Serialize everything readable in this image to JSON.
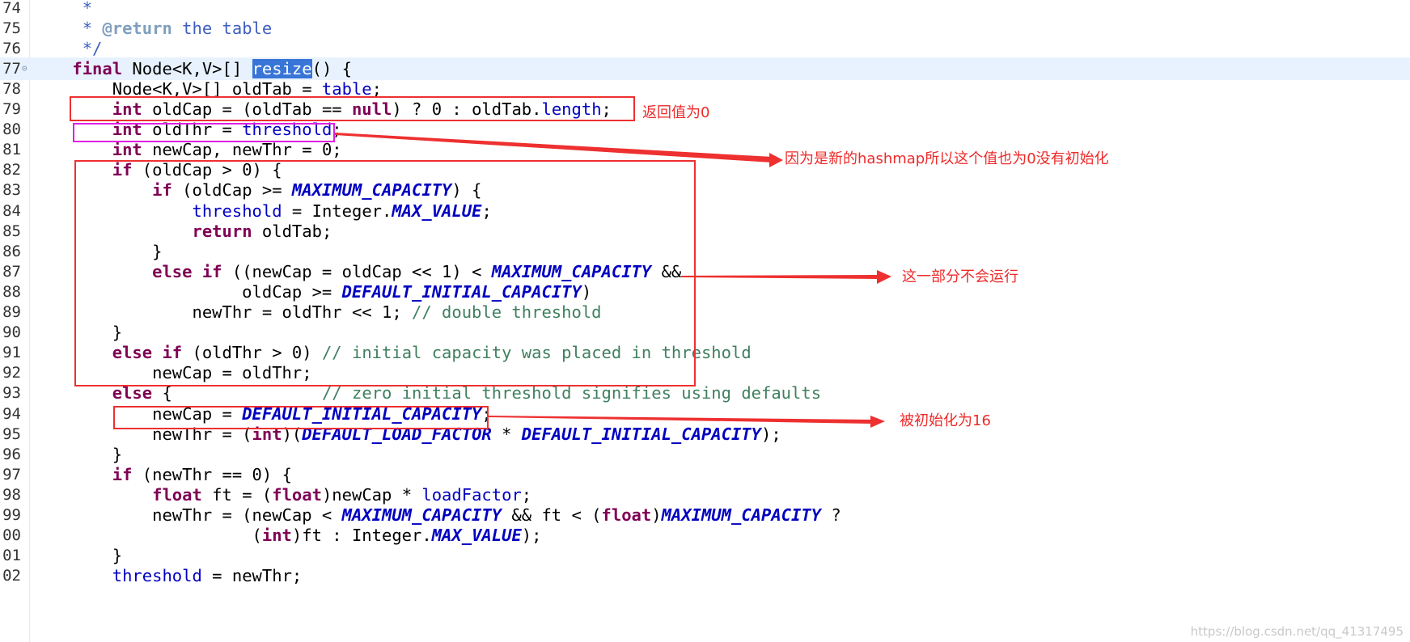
{
  "lines": [
    {
      "num": "74",
      "parts": [
        {
          "t": "     *",
          "c": "jd"
        }
      ]
    },
    {
      "num": "75",
      "parts": [
        {
          "t": "     * ",
          "c": "jd"
        },
        {
          "t": "@return",
          "c": "tag"
        },
        {
          "t": " the table",
          "c": "jd"
        }
      ]
    },
    {
      "num": "76",
      "parts": [
        {
          "t": "     */",
          "c": "jd"
        }
      ]
    },
    {
      "num": "77",
      "current": true,
      "fold": true,
      "parts": [
        {
          "t": "    "
        },
        {
          "t": "final",
          "c": "kw"
        },
        {
          "t": " Node<K,V>[] "
        },
        {
          "t": "resize",
          "c": "sel"
        },
        {
          "t": "() {"
        }
      ]
    },
    {
      "num": "78",
      "parts": [
        {
          "t": "        Node<K,V>[] oldTab = "
        },
        {
          "t": "table",
          "c": "fld"
        },
        {
          "t": ";"
        }
      ]
    },
    {
      "num": "79",
      "parts": [
        {
          "t": "        "
        },
        {
          "t": "int",
          "c": "kw"
        },
        {
          "t": " oldCap = (oldTab == "
        },
        {
          "t": "null",
          "c": "kw"
        },
        {
          "t": ") ? 0 : oldTab."
        },
        {
          "t": "length",
          "c": "fld"
        },
        {
          "t": ";"
        }
      ]
    },
    {
      "num": "80",
      "parts": [
        {
          "t": "        "
        },
        {
          "t": "int",
          "c": "kw"
        },
        {
          "t": " oldThr = "
        },
        {
          "t": "threshold",
          "c": "fld"
        },
        {
          "t": ";"
        }
      ]
    },
    {
      "num": "81",
      "parts": [
        {
          "t": "        "
        },
        {
          "t": "int",
          "c": "kw"
        },
        {
          "t": " newCap, newThr = 0;"
        }
      ]
    },
    {
      "num": "82",
      "parts": [
        {
          "t": "        "
        },
        {
          "t": "if",
          "c": "kw"
        },
        {
          "t": " (oldCap > 0) {"
        }
      ]
    },
    {
      "num": "83",
      "parts": [
        {
          "t": "            "
        },
        {
          "t": "if",
          "c": "kw"
        },
        {
          "t": " (oldCap >= "
        },
        {
          "t": "MAXIMUM_CAPACITY",
          "c": "cst"
        },
        {
          "t": ") {"
        }
      ]
    },
    {
      "num": "84",
      "parts": [
        {
          "t": "                "
        },
        {
          "t": "threshold",
          "c": "fld"
        },
        {
          "t": " = Integer."
        },
        {
          "t": "MAX_VALUE",
          "c": "cst"
        },
        {
          "t": ";"
        }
      ]
    },
    {
      "num": "85",
      "parts": [
        {
          "t": "                "
        },
        {
          "t": "return",
          "c": "kw"
        },
        {
          "t": " oldTab;"
        }
      ]
    },
    {
      "num": "86",
      "parts": [
        {
          "t": "            }"
        }
      ]
    },
    {
      "num": "87",
      "parts": [
        {
          "t": "            "
        },
        {
          "t": "else if",
          "c": "kw"
        },
        {
          "t": " ((newCap = oldCap << 1) < "
        },
        {
          "t": "MAXIMUM_CAPACITY",
          "c": "cst"
        },
        {
          "t": " &&"
        }
      ]
    },
    {
      "num": "88",
      "parts": [
        {
          "t": "                     oldCap >= "
        },
        {
          "t": "DEFAULT_INITIAL_CAPACITY",
          "c": "cst"
        },
        {
          "t": ")"
        }
      ]
    },
    {
      "num": "89",
      "parts": [
        {
          "t": "                newThr = oldThr << 1; "
        },
        {
          "t": "// double threshold",
          "c": "cmt"
        }
      ]
    },
    {
      "num": "90",
      "parts": [
        {
          "t": "        }"
        }
      ]
    },
    {
      "num": "91",
      "parts": [
        {
          "t": "        "
        },
        {
          "t": "else if",
          "c": "kw"
        },
        {
          "t": " (oldThr > 0) "
        },
        {
          "t": "// initial capacity was placed in threshold",
          "c": "cmt"
        }
      ]
    },
    {
      "num": "92",
      "parts": [
        {
          "t": "            newCap = oldThr;"
        }
      ]
    },
    {
      "num": "93",
      "parts": [
        {
          "t": "        "
        },
        {
          "t": "else",
          "c": "kw"
        },
        {
          "t": " {               "
        },
        {
          "t": "// zero initial threshold signifies using defaults",
          "c": "cmt"
        }
      ]
    },
    {
      "num": "94",
      "parts": [
        {
          "t": "            newCap = "
        },
        {
          "t": "DEFAULT_INITIAL_CAPACITY",
          "c": "cst"
        },
        {
          "t": ";"
        }
      ]
    },
    {
      "num": "95",
      "parts": [
        {
          "t": "            newThr = ("
        },
        {
          "t": "int",
          "c": "kw"
        },
        {
          "t": ")("
        },
        {
          "t": "DEFAULT_LOAD_FACTOR",
          "c": "cst"
        },
        {
          "t": " * "
        },
        {
          "t": "DEFAULT_INITIAL_CAPACITY",
          "c": "cst"
        },
        {
          "t": ");"
        }
      ]
    },
    {
      "num": "96",
      "parts": [
        {
          "t": "        }"
        }
      ]
    },
    {
      "num": "97",
      "parts": [
        {
          "t": "        "
        },
        {
          "t": "if",
          "c": "kw"
        },
        {
          "t": " (newThr == 0) {"
        }
      ]
    },
    {
      "num": "98",
      "parts": [
        {
          "t": "            "
        },
        {
          "t": "float",
          "c": "kw"
        },
        {
          "t": " ft = ("
        },
        {
          "t": "float",
          "c": "kw"
        },
        {
          "t": ")newCap * "
        },
        {
          "t": "loadFactor",
          "c": "fld"
        },
        {
          "t": ";"
        }
      ]
    },
    {
      "num": "99",
      "parts": [
        {
          "t": "            newThr = (newCap < "
        },
        {
          "t": "MAXIMUM_CAPACITY",
          "c": "cst"
        },
        {
          "t": " && ft < ("
        },
        {
          "t": "float",
          "c": "kw"
        },
        {
          "t": ")"
        },
        {
          "t": "MAXIMUM_CAPACITY",
          "c": "cst"
        },
        {
          "t": " ?"
        }
      ]
    },
    {
      "num": "00",
      "parts": [
        {
          "t": "                      ("
        },
        {
          "t": "int",
          "c": "kw"
        },
        {
          "t": ")ft : Integer."
        },
        {
          "t": "MAX_VALUE",
          "c": "cst"
        },
        {
          "t": ");"
        }
      ]
    },
    {
      "num": "01",
      "parts": [
        {
          "t": "        }"
        }
      ]
    },
    {
      "num": "02",
      "parts": [
        {
          "t": "        "
        },
        {
          "t": "threshold",
          "c": "fld"
        },
        {
          "t": " = newThr;"
        }
      ]
    }
  ],
  "annotations": {
    "return_zero": "返回值为0",
    "new_hashmap": "因为是新的hashmap所以这个值也为0没有初始化",
    "not_run": "这一部分不会运行",
    "init_16": "被初始化为16"
  },
  "watermark": "https://blog.csdn.net/qq_41317495",
  "colors": {
    "keyword": "#7f0055",
    "field": "#0000c0",
    "comment": "#3f7f5f",
    "javadoc": "#3f5fbf",
    "annotation_red": "#ee3030",
    "annotation_magenta": "#e020e0",
    "selection": "#3875d7",
    "current_line": "#e8f2fe"
  }
}
